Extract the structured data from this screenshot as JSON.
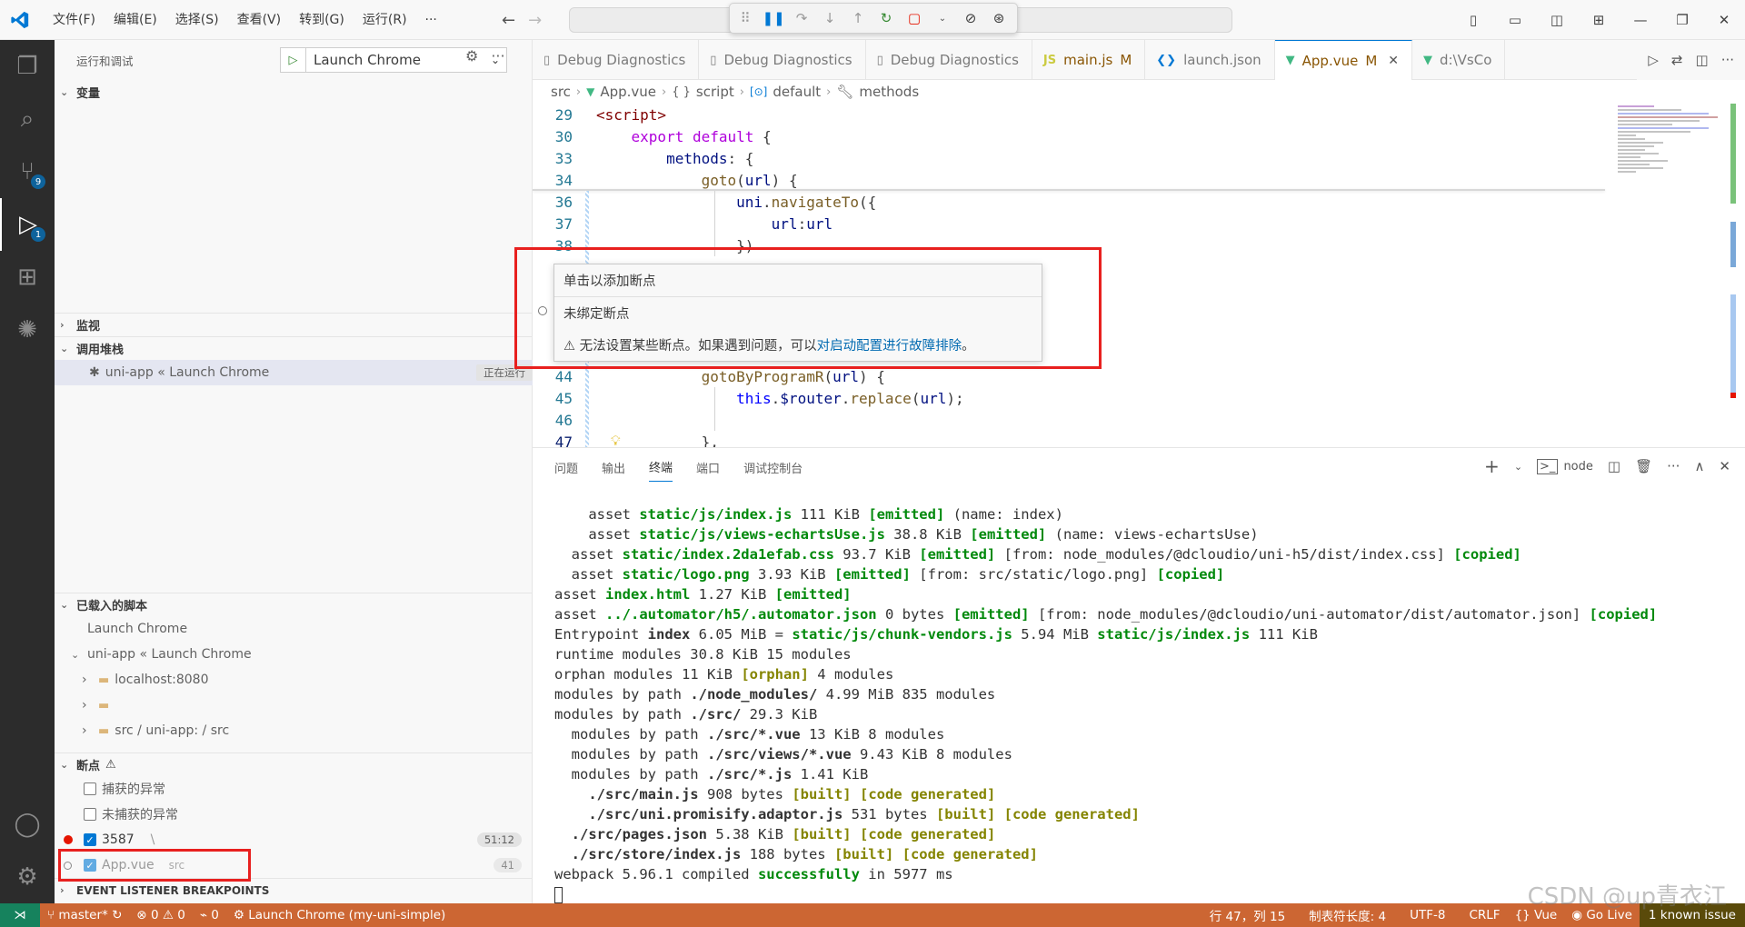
{
  "titlebar": {
    "menu": [
      "文件(F)",
      "编辑(E)",
      "选择(S)",
      "查看(V)",
      "转到(G)",
      "运行(R)",
      "···"
    ]
  },
  "activity": {
    "scm_badge": "9",
    "debug_badge": "1"
  },
  "sidebar": {
    "title": "运行和调试",
    "launch_config": "Launch Chrome",
    "variables": "变量",
    "watch": "监视",
    "callstack": "调用堆栈",
    "callstack_item": "uni-app « Launch Chrome",
    "callstack_status": "正在运行",
    "loaded_scripts": "已载入的脚本",
    "loaded": [
      {
        "label": "Launch Chrome"
      },
      {
        "label": "uni-app « Launch Chrome"
      },
      {
        "label": "localhost:8080"
      },
      {
        "label": ""
      },
      {
        "label": "src / uni-app: / src"
      }
    ],
    "breakpoints": "断点",
    "bp_caught": "捕获的异常",
    "bp_uncaught": "未捕获的异常",
    "bp1_name": "3587",
    "bp1_extra": "\\",
    "bp1_pos": "51:12",
    "bp2_name": "App.vue",
    "bp2_path": "src",
    "bp2_line": "41",
    "event_listener": "EVENT LISTENER BREAKPOINTS"
  },
  "tabs": [
    {
      "label": "Debug Diagnostics",
      "icon": "file-icon"
    },
    {
      "label": "Debug Diagnostics",
      "icon": "file-icon"
    },
    {
      "label": "Debug Diagnostics",
      "icon": "file-icon"
    },
    {
      "label": "main.js",
      "icon": "js-icon",
      "mod": "M"
    },
    {
      "label": "launch.json",
      "icon": "vscode-icon"
    },
    {
      "label": "App.vue",
      "icon": "vue-icon",
      "mod": "M",
      "active": true
    },
    {
      "label": "d:\\VsCo",
      "icon": "vue-icon"
    }
  ],
  "breadcrumb": {
    "src": "src",
    "file": "App.vue",
    "script": "script",
    "default": "default",
    "methods": "methods"
  },
  "code": {
    "lines": [
      {
        "n": "29",
        "t": "<script>"
      },
      {
        "n": "30",
        "t": "    export default {"
      },
      {
        "n": "33",
        "t": "        methods: {"
      },
      {
        "n": "34",
        "t": "            goto(url) {"
      },
      {
        "n": "36",
        "t": "                uni.navigateTo({"
      },
      {
        "n": "37",
        "t": "                    url:url"
      },
      {
        "n": "38",
        "t": "                })"
      },
      {
        "n": "44",
        "t": "            gotoByProgramR(url) {"
      },
      {
        "n": "45",
        "t": "                this.$router.replace(url);"
      },
      {
        "n": "46",
        "t": ""
      },
      {
        "n": "47",
        "t": "            },"
      }
    ]
  },
  "hover": {
    "title": "单击以添加断点",
    "subtitle": "未绑定断点",
    "warning": "⚠ 无法设置某些断点。如果遇到问题，可以 ",
    "link": "对启动配置进行故障排除",
    "end": "。"
  },
  "panel": {
    "tabs": [
      "问题",
      "输出",
      "终端",
      "端口",
      "调试控制台"
    ],
    "active_tab": "终端",
    "terminal_name": "node",
    "lines": [
      [
        [
          "    asset ",
          ""
        ],
        [
          "static/js/index.js",
          "g"
        ],
        [
          " 111 KiB ",
          ""
        ],
        [
          "[emitted]",
          "g"
        ],
        [
          " (name: index)",
          ""
        ]
      ],
      [
        [
          "    asset ",
          ""
        ],
        [
          "static/js/views-echartsUse.js",
          "g"
        ],
        [
          " 38.8 KiB ",
          ""
        ],
        [
          "[emitted]",
          "g"
        ],
        [
          " (name: views-echartsUse)",
          ""
        ]
      ],
      [
        [
          "  asset ",
          ""
        ],
        [
          "static/index.2da1efab.css",
          "g"
        ],
        [
          " 93.7 KiB ",
          ""
        ],
        [
          "[emitted]",
          "g"
        ],
        [
          " [from: node_modules/@dcloudio/uni-h5/dist/index.css] ",
          ""
        ],
        [
          "[copied]",
          "g"
        ]
      ],
      [
        [
          "  asset ",
          ""
        ],
        [
          "static/logo.png",
          "g"
        ],
        [
          " 3.93 KiB ",
          ""
        ],
        [
          "[emitted]",
          "g"
        ],
        [
          " [from: src/static/logo.png] ",
          ""
        ],
        [
          "[copied]",
          "g"
        ]
      ],
      [
        [
          "asset ",
          ""
        ],
        [
          "index.html",
          "g"
        ],
        [
          " 1.27 KiB ",
          ""
        ],
        [
          "[emitted]",
          "g"
        ]
      ],
      [
        [
          "asset ",
          ""
        ],
        [
          "../.automator/h5/.automator.json",
          "g"
        ],
        [
          " 0 bytes ",
          ""
        ],
        [
          "[emitted]",
          "g"
        ],
        [
          " [from: node_modules/@dcloudio/uni-automator/dist/automator.json] ",
          ""
        ],
        [
          "[copied]",
          "g"
        ]
      ],
      [
        [
          "Entrypoint ",
          ""
        ],
        [
          "index",
          "b"
        ],
        [
          " 6.05 MiB = ",
          ""
        ],
        [
          "static/js/chunk-vendors.js",
          "g"
        ],
        [
          " 5.94 MiB ",
          ""
        ],
        [
          "static/js/index.js",
          "g"
        ],
        [
          " 111 KiB",
          ""
        ]
      ],
      [
        [
          "runtime modules 30.8 KiB 15 modules",
          ""
        ]
      ],
      [
        [
          "orphan modules 11 KiB ",
          ""
        ],
        [
          "[orphan]",
          "y"
        ],
        [
          " 4 modules",
          ""
        ]
      ],
      [
        [
          "modules by path ",
          ""
        ],
        [
          "./node_modules/",
          "b"
        ],
        [
          " 4.99 MiB 835 modules",
          ""
        ]
      ],
      [
        [
          "modules by path ",
          ""
        ],
        [
          "./src/",
          "b"
        ],
        [
          " 29.3 KiB",
          ""
        ]
      ],
      [
        [
          "  modules by path ",
          ""
        ],
        [
          "./src/*.vue",
          "b"
        ],
        [
          " 13 KiB 8 modules",
          ""
        ]
      ],
      [
        [
          "  modules by path ",
          ""
        ],
        [
          "./src/views/*.vue",
          "b"
        ],
        [
          " 9.43 KiB 8 modules",
          ""
        ]
      ],
      [
        [
          "  modules by path ",
          ""
        ],
        [
          "./src/*.js",
          "b"
        ],
        [
          " 1.41 KiB",
          ""
        ]
      ],
      [
        [
          "    ",
          ""
        ],
        [
          "./src/main.js",
          "b"
        ],
        [
          " 908 bytes ",
          ""
        ],
        [
          "[built]",
          "y"
        ],
        [
          " ",
          ""
        ],
        [
          "[code generated]",
          "y"
        ]
      ],
      [
        [
          "    ",
          ""
        ],
        [
          "./src/uni.promisify.adaptor.js",
          "b"
        ],
        [
          " 531 bytes ",
          ""
        ],
        [
          "[built]",
          "y"
        ],
        [
          " ",
          ""
        ],
        [
          "[code generated]",
          "y"
        ]
      ],
      [
        [
          "  ",
          ""
        ],
        [
          "./src/pages.json",
          "b"
        ],
        [
          " 5.38 KiB ",
          ""
        ],
        [
          "[built]",
          "y"
        ],
        [
          " ",
          ""
        ],
        [
          "[code generated]",
          "y"
        ]
      ],
      [
        [
          "  ",
          ""
        ],
        [
          "./src/store/index.js",
          "b"
        ],
        [
          " 188 bytes ",
          ""
        ],
        [
          "[built]",
          "y"
        ],
        [
          " ",
          ""
        ],
        [
          "[code generated]",
          "y"
        ]
      ],
      [
        [
          "webpack 5.96.1 compiled ",
          ""
        ],
        [
          "successfully",
          "g"
        ],
        [
          " in 5977 ms",
          ""
        ]
      ]
    ]
  },
  "status": {
    "branch": "master*",
    "errors": "⊗ 0 ⚠ 0",
    "ports": "0",
    "debug": "Launch Chrome (my-uni-simple)",
    "position": "行 47，列 15",
    "tab": "制表符长度: 4",
    "encoding": "UTF-8",
    "eol": "CRLF",
    "lang": "Vue",
    "golive": "Go Live",
    "issue": "1 known issue"
  },
  "watermark": "CSDN @up青衣江"
}
